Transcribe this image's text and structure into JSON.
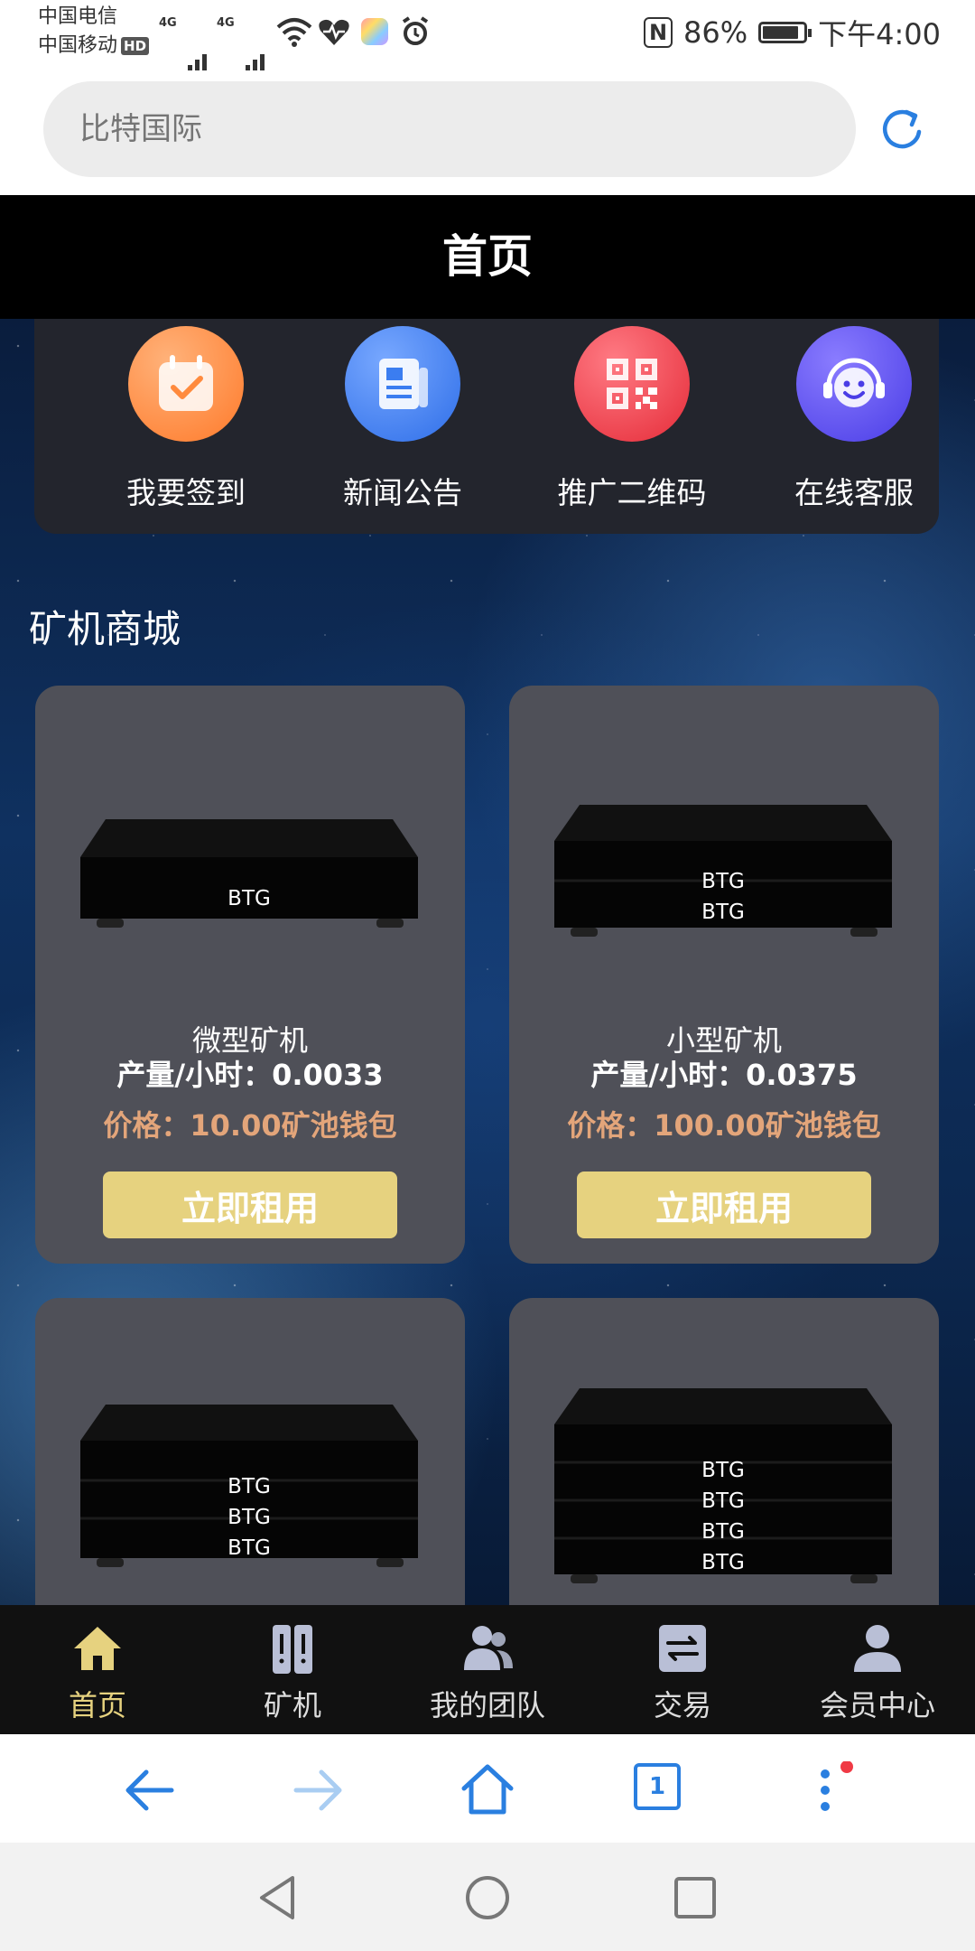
{
  "status_bar": {
    "carrier1": "中国电信",
    "carrier2": "中国移动",
    "hd": "HD",
    "net1": "4G",
    "net2": "4G",
    "nfc": "N",
    "battery": "86%",
    "time": "下午4:00"
  },
  "browser": {
    "url_placeholder": "比特国际",
    "tab_count": "1"
  },
  "header": {
    "title": "首页"
  },
  "quick_links": [
    {
      "label": "我要签到",
      "icon": "calendar-check-icon",
      "color": "#ff8a3d"
    },
    {
      "label": "新闻公告",
      "icon": "news-icon",
      "color": "#3b7df0"
    },
    {
      "label": "推广二维码",
      "icon": "qr-code-icon",
      "color": "#f03a45"
    },
    {
      "label": "在线客服",
      "icon": "customer-service-icon",
      "color": "#5b4df0"
    }
  ],
  "section": {
    "title": "矿机商城"
  },
  "products": [
    {
      "name": "微型矿机",
      "yield": "产量/小时：0.0033",
      "price": "价格：10.00矿池钱包",
      "button": "立即租用",
      "layers": 1,
      "labels": [
        "BTG"
      ]
    },
    {
      "name": "小型矿机",
      "yield": "产量/小时：0.0375",
      "price": "价格：100.00矿池钱包",
      "button": "立即租用",
      "layers": 2,
      "labels": [
        "BTG",
        "BTG"
      ]
    },
    {
      "layers": 3,
      "labels": [
        "BTG",
        "BTG",
        "BTG"
      ]
    },
    {
      "layers": 4,
      "labels": [
        "BTG",
        "BTG",
        "BTG",
        "BTG"
      ]
    }
  ],
  "bottom_nav": [
    {
      "label": "首页",
      "active": true
    },
    {
      "label": "矿机",
      "active": false
    },
    {
      "label": "我的团队",
      "active": false
    },
    {
      "label": "交易",
      "active": false
    },
    {
      "label": "会员中心",
      "active": false
    }
  ],
  "colors": {
    "accent": "#e6d27f",
    "price": "#e3a57a",
    "card": "#4f5058",
    "header": "#000000"
  }
}
